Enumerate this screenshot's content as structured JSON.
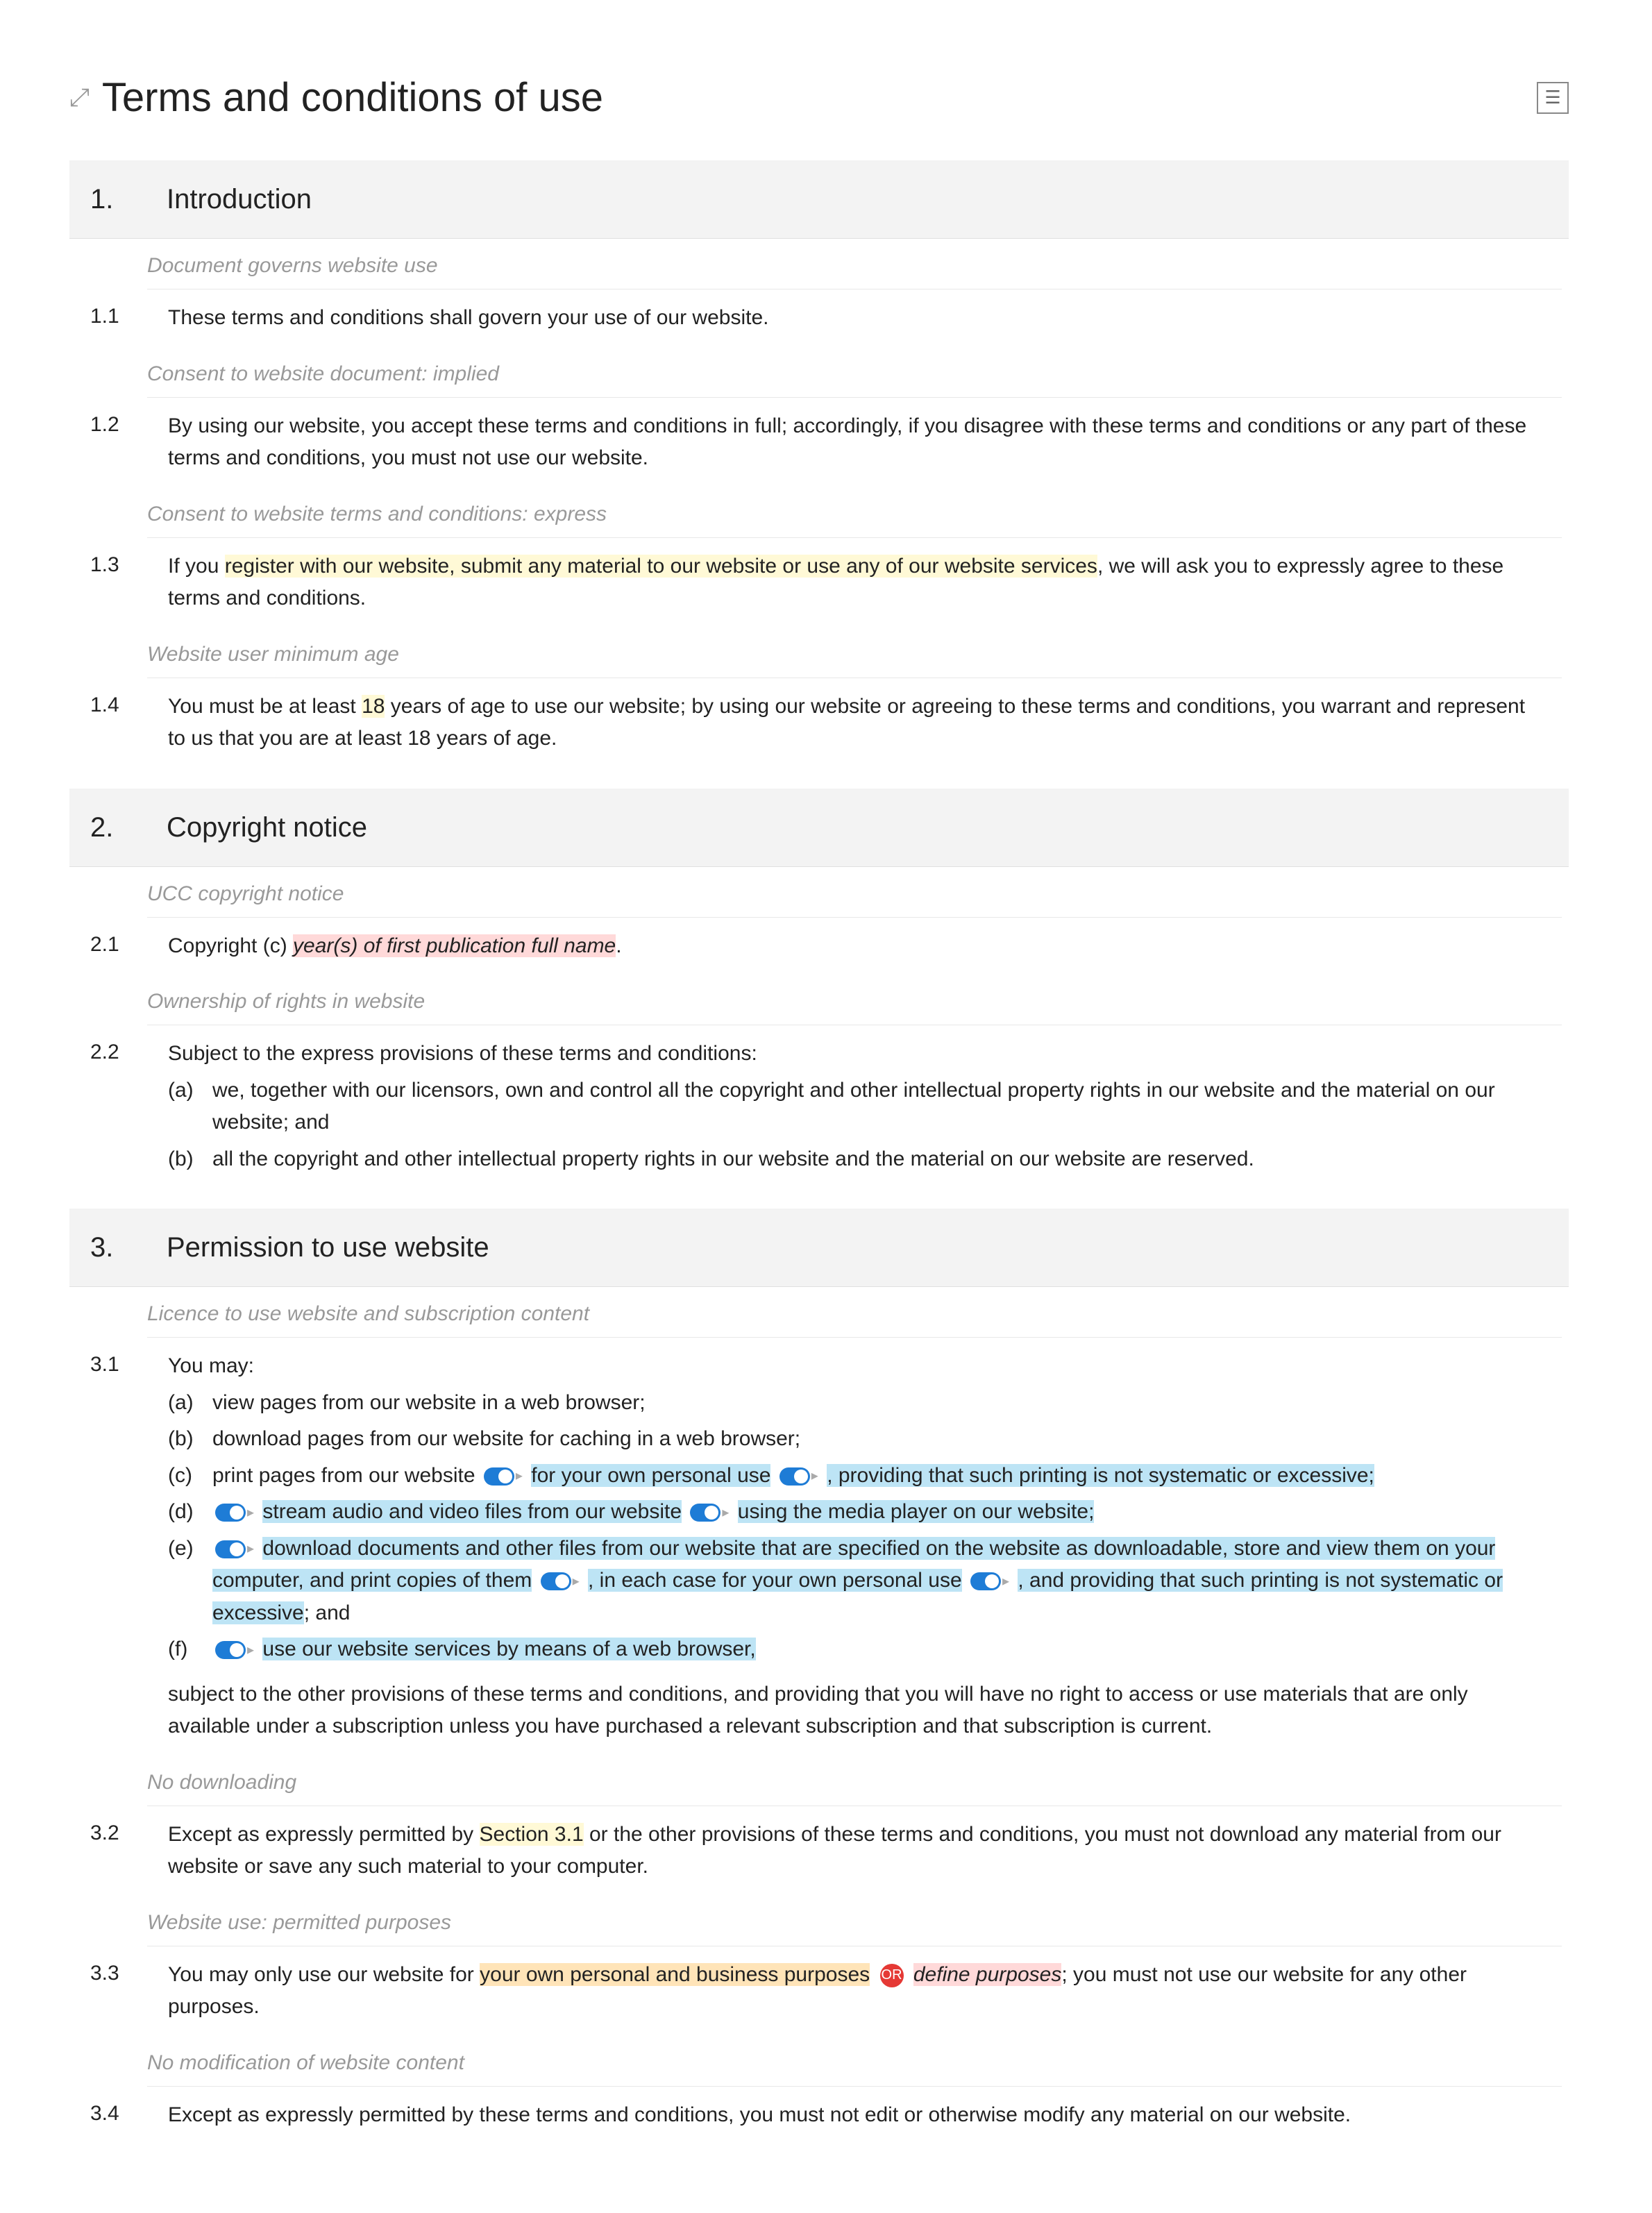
{
  "title": "Terms and conditions of use",
  "sections": [
    {
      "num": "1.",
      "title": "Introduction"
    },
    {
      "num": "2.",
      "title": "Copyright notice"
    },
    {
      "num": "3.",
      "title": "Permission to use website"
    }
  ],
  "notes": {
    "n0": "Document governs website use",
    "n1": "Consent to website document: implied",
    "n2": "Consent to website terms and conditions: express",
    "n3": "Website user minimum age",
    "n4": "UCC copyright notice",
    "n5": "Ownership of rights in website",
    "n6": "Licence to use website and subscription content",
    "n7": "No downloading",
    "n8": "Website use: permitted purposes",
    "n9": "No modification of website content"
  },
  "c": {
    "c11_num": "1.1",
    "c11": "These terms and conditions shall govern your use of our website.",
    "c12_num": "1.2",
    "c12": "By using our website, you accept these terms and conditions in full; accordingly, if you disagree with these terms and conditions or any part of these terms and conditions, you must not use our website.",
    "c13_num": "1.3",
    "c13_a": "If you ",
    "c13_hl": "register with our website, submit any material to our website or use any of our website services",
    "c13_b": ", we will ask you to expressly agree to these terms and conditions.",
    "c14_num": "1.4",
    "c14_a": "You must be at least ",
    "c14_hl": "18",
    "c14_b": " years of age to use our website; by using our website or agreeing to these terms and conditions, you warrant and represent to us that you are at least 18 years of age.",
    "c21_num": "2.1",
    "c21_a": "Copyright (c) ",
    "c21_ph": "year(s) of first publication full name",
    "c21_b": ".",
    "c22_num": "2.2",
    "c22_intro": "Subject to the express provisions of these terms and conditions:",
    "c22a_l": "(a)",
    "c22a": "we, together with our licensors, own and control all the copyright and other intellectual property rights in our website and the material on our website; and",
    "c22b_l": "(b)",
    "c22b": "all the copyright and other intellectual property rights in our website and the material on our website are reserved.",
    "c31_num": "3.1",
    "c31_intro": "You may:",
    "c31a_l": "(a)",
    "c31a": "view pages from our website in a web browser;",
    "c31b_l": "(b)",
    "c31b": "download pages from our website for caching in a web browser;",
    "c31c_l": "(c)",
    "c31c_1": "print pages from our website",
    "c31c_hl1": " for your own personal use",
    "c31c_hl2": ", providing that such printing is not systematic or excessive;",
    "c31d_l": "(d)",
    "c31d_1": "stream audio and video files from our website",
    "c31d_hl": " using the media player on our website;",
    "c31e_l": "(e)",
    "c31e_hl1": "download documents and other files from our website that are specified on the website as downloadable, store and view them on your computer, and print copies of them",
    "c31e_hl2": ", in each case for your own personal use",
    "c31e_hl3": ", and providing that such printing is not systematic or excessive",
    "c31e_tail": "; and",
    "c31f_l": "(f)",
    "c31f_hl": "use our website services by means of a web browser,",
    "c31_outro": "subject to the other provisions of these terms and conditions, and providing that you will have no right to access or use materials that are only available under a subscription unless you have purchased a relevant subscription and that subscription is current.",
    "c32_num": "3.2",
    "c32_a": "Except as expressly permitted by ",
    "c32_hl": "Section 3.1",
    "c32_b": " or the other provisions of these terms and conditions, you must not download any material from our website or save any such material to your computer.",
    "c33_num": "3.3",
    "c33_a": "You may only use our website for ",
    "c33_hl1": "your own personal and business purposes",
    "c33_or": "OR",
    "c33_hl2": "define purposes",
    "c33_b": "; you must not use our website for any other purposes.",
    "c34_num": "3.4",
    "c34": "Except as expressly permitted by these terms and conditions, you must not edit or otherwise modify any material on our website."
  }
}
